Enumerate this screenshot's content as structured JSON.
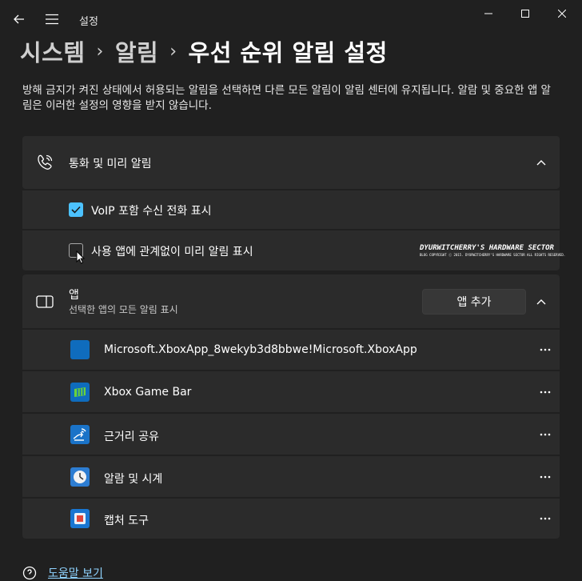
{
  "window": {
    "title": "설정"
  },
  "breadcrumb": {
    "items": [
      "시스템",
      "알림"
    ],
    "current": "우선 순위 알림 설정",
    "separator": "›"
  },
  "description": "방해 금지가 켜진 상태에서 허용되는 알림을 선택하면 다른 모든 알림이 알림 센터에 유지됩니다. 알람 및 중요한 앱 알림은 이러한 설정의 영향을 받지 않습니다.",
  "calls_section": {
    "title": "통화 및 미리 알림",
    "options": [
      {
        "label": "VoIP 포함 수신 전화 표시",
        "checked": true
      },
      {
        "label": "사용 앱에 관계없이 미리 알림 표시",
        "checked": false
      }
    ]
  },
  "watermark": {
    "title": "DYURWITCHERRY'S HARDWARE SECTOR",
    "subtitle": "BLOG COPYRIGHT ⓒ 2015. DYURWITCHERRY'S HARDWARE SECTOR ALL RIGHTS RESERVED."
  },
  "apps_section": {
    "title": "앱",
    "subtitle": "선택한 앱의 모든 알림 표시",
    "add_button": "앱 추가",
    "apps": [
      {
        "name": "Microsoft.XboxApp_8wekyb3d8bbwe!Microsoft.XboxApp",
        "icon": "xbox-app-icon",
        "color": "#0f6cbd"
      },
      {
        "name": "Xbox Game Bar",
        "icon": "xbox-game-bar-icon",
        "color": "#107c10"
      },
      {
        "name": "근거리 공유",
        "icon": "nearby-share-icon",
        "color": "#1a73c8"
      },
      {
        "name": "알람 및 시계",
        "icon": "alarm-clock-icon",
        "color": "#2d7dd2"
      },
      {
        "name": "캡처 도구",
        "icon": "snipping-tool-icon",
        "color": "#1976d2"
      }
    ]
  },
  "help_link": "도움말 보기",
  "colors": {
    "background": "#202020",
    "card": "#2b2b2b",
    "accent": "#4cc2ff"
  }
}
